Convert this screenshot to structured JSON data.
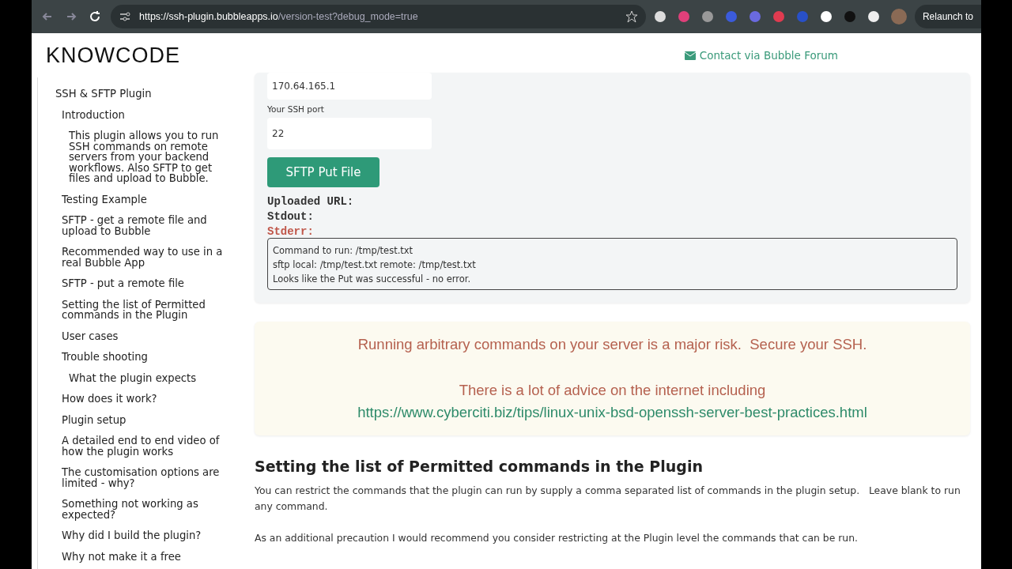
{
  "browser": {
    "url_host": "https://ssh-plugin.bubbleapps.io",
    "url_path": "/version-test?debug_mode=true",
    "relaunch": "Relaunch to"
  },
  "header": {
    "logo": "KNOWCODE",
    "contact": "Contact via Bubble Forum"
  },
  "sidebar": {
    "items": [
      {
        "label": "SSH & SFTP Plugin",
        "children": [
          {
            "label": "Introduction",
            "children": [
              {
                "label": "This plugin allows you to run SSH commands on remote servers from your backend workflows. Also SFTP to get files and upload to Bubble."
              }
            ]
          },
          {
            "label": "Testing Example"
          },
          {
            "label": "SFTP - get a remote file and upload to Bubble"
          },
          {
            "label": "Recommended way to use in a real Bubble App"
          },
          {
            "label": "SFTP - put a remote file"
          },
          {
            "label": "Setting the list of Permitted commands in the Plugin"
          },
          {
            "label": "User cases"
          },
          {
            "label": "Trouble shooting",
            "children": [
              {
                "label": "What the plugin expects"
              }
            ]
          },
          {
            "label": "How does it work?"
          },
          {
            "label": "Plugin setup"
          },
          {
            "label": "A detailed end to end video of how the plugin works"
          },
          {
            "label": "The customisation options are limited - why?"
          },
          {
            "label": "Something not working as expected?"
          },
          {
            "label": "Why did I build the plugin?"
          },
          {
            "label": "Why not make it a free"
          }
        ]
      }
    ]
  },
  "form": {
    "host_value": "170.64.165.1",
    "port_label": "Your SSH port",
    "port_value": "22",
    "button": "SFTP Put File",
    "outputs": [
      {
        "label": "Uploaded URL:",
        "kind": "normal"
      },
      {
        "label": "Stdout:",
        "kind": "normal"
      },
      {
        "label": "Stderr:",
        "kind": "error"
      }
    ],
    "log": [
      "Command to run: /tmp/test.txt",
      "sftp local: /tmp/test.txt remote: /tmp/test.txt",
      "Looks like the Put was successful - no error."
    ]
  },
  "warning": {
    "lines": [
      "Running arbitrary commands on your server is a major risk.  Secure your SSH.",
      "There is a lot of advice on the internet including"
    ],
    "link": "https://www.cyberciti.biz/tips/linux-unix-bsd-openssh-server-best-practices.html"
  },
  "section": {
    "heading": "Setting the list of Permitted commands in the Plugin",
    "paragraphs": [
      "You can restrict the commands that the plugin can run by supply a comma separated list of commands in the plugin setup.   Leave blank to run any command.",
      "As an additional precaution I would recommend you consider restricting at the Plugin level the commands that can be run."
    ]
  }
}
